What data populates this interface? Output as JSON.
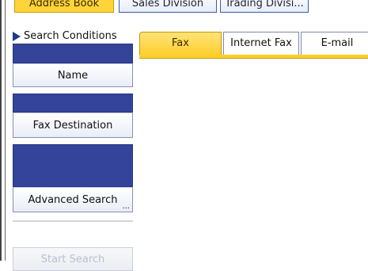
{
  "address_tabs": [
    {
      "label": "Address Book",
      "active": true
    },
    {
      "label": "Sales Division",
      "active": false
    },
    {
      "label": "Trading Divisi...",
      "active": false
    }
  ],
  "search_conditions": {
    "header": "Search Conditions",
    "name_button": "Name",
    "fax_destination_button": "Fax Destination",
    "advanced_search_button": "Advanced Search",
    "advanced_search_ellipsis": "...",
    "start_search_button": "Start Search"
  },
  "dest_tabs": [
    {
      "label": "Fax",
      "active": true
    },
    {
      "label": "Internet Fax",
      "active": false
    },
    {
      "label": "E-mail",
      "active": false
    }
  ],
  "colors": {
    "accent_yellow": "#ffcf2b",
    "panel_blue": "#33449a"
  }
}
